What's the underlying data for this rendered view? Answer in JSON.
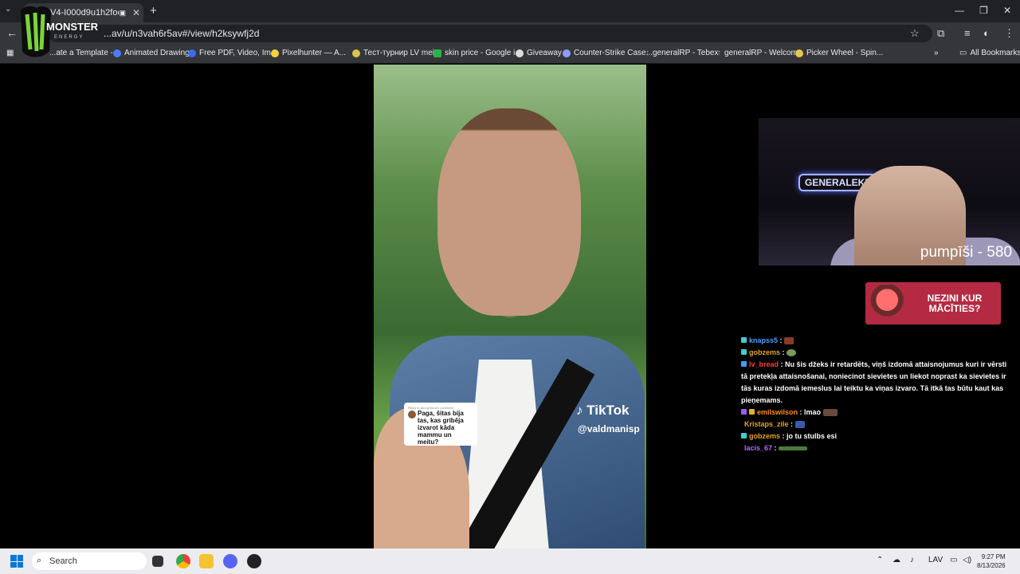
{
  "browser": {
    "tab_title": "...VOV4-I000d9u1h2foo6",
    "url": "...av/u/n3vah6r5av#/view/h2ksywfj2d",
    "logo_text": "MONSTER ENERGY",
    "bookmarks": [
      "...ate a Template -...",
      "Animated Drawings",
      "Free PDF, Video, Im...",
      "Pixelhunter — A...",
      "Тест-турнир LV mei...",
      "skin price - Google i...",
      "Giveaway",
      "Counter-Strike Case...",
      "generalRP - Tebex",
      "generalRP - Welcome",
      "Picker Wheel - Spin..."
    ],
    "all_bookmarks": "All Bookmarks"
  },
  "video": {
    "reply_header": "Reply to anonymous's comment",
    "reply_text": "Paga, šitas bija tas, kas gribēja izvarot kāda mammu un meitu?",
    "brand": "TikTok",
    "handle": "@valdmanisp"
  },
  "webcam": {
    "neon_sign": "GENERALEKE",
    "overlay": "pumpīši - 580"
  },
  "ad": {
    "text": "NEZINI KUR MĀCĪTIES?"
  },
  "chat": [
    {
      "user": "knapss5",
      "color": "#4a9fff",
      "message": ""
    },
    {
      "user": "gobzems",
      "color": "#e3a324",
      "message": ""
    },
    {
      "user": "lv_bread",
      "color": "#ff3a3a",
      "message": "Nu šis džeks ir retardēts, viņš izdomā attaisnojumus kuri ir vērsti tā pretekļa attaisnošanai, noniecinot sievietes un liekot noprast ka sievietes ir tās kuras izdomā iemeslus lai teiktu ka viņas izvaro. Tā itkā tas būtu kaut kas pieņemams."
    },
    {
      "user": "emilswilson",
      "color": "#ff8c1a",
      "message": "lmao"
    },
    {
      "user": "Kristaps_zile",
      "color": "#e3a324",
      "message": ""
    },
    {
      "user": "gobzems",
      "color": "#e3a324",
      "message": "jo tu stulbs esi"
    },
    {
      "user": "lacis_67",
      "color": "#b06bff",
      "message": ""
    }
  ],
  "taskbar": {
    "search_placeholder": "Search",
    "language": "LAV",
    "time": "9:27 PM",
    "date": "8/13/2026"
  }
}
